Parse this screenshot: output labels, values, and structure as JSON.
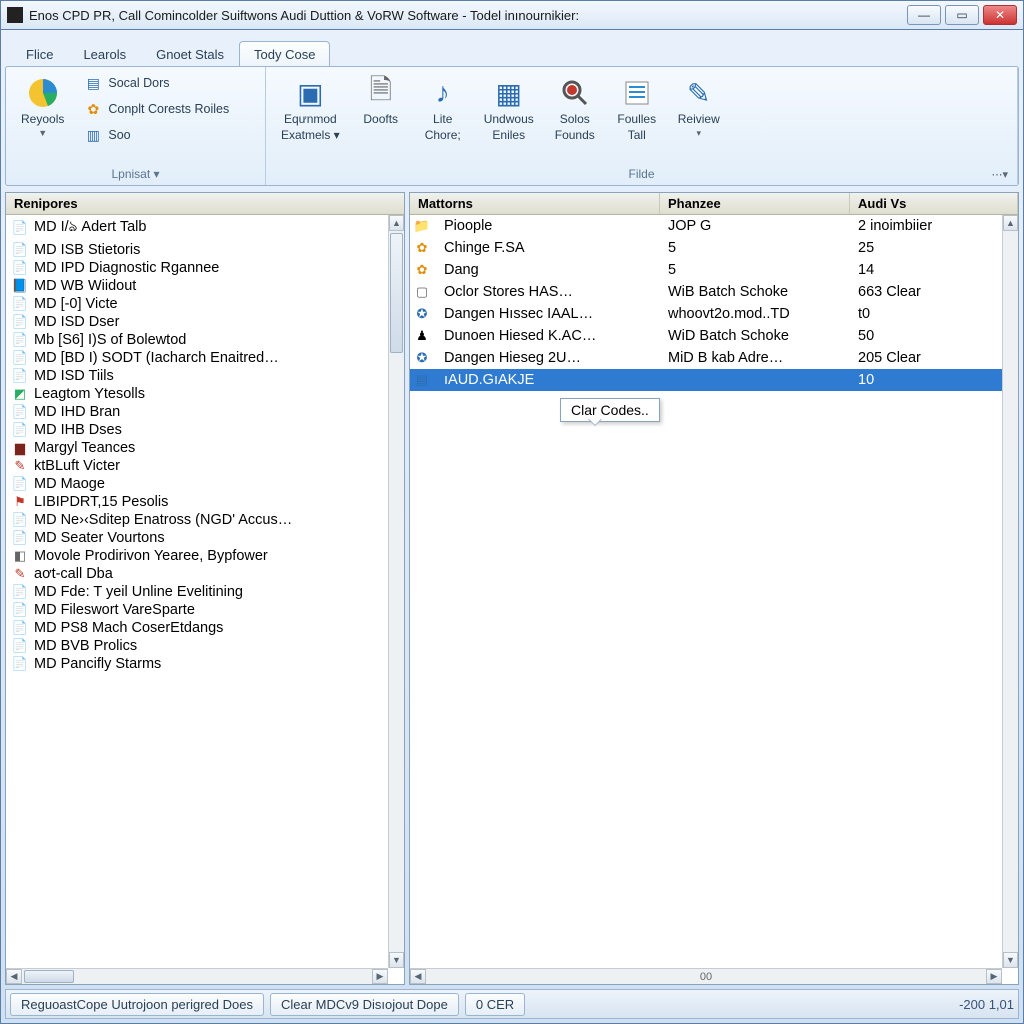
{
  "window": {
    "title": "Enos CPD PR, Call Comincolder Suiftwons Audi Duttion & VoRW Software - Todel inınournikier:"
  },
  "tabs": [
    {
      "label": "Flice"
    },
    {
      "label": "Learols"
    },
    {
      "label": "Gnoet Stals"
    },
    {
      "label": "Tody Cose",
      "active": true
    }
  ],
  "ribbon": {
    "group1": {
      "caption": "Lpnisat ▾",
      "bigbtn": {
        "label": "Reyools"
      },
      "small": [
        {
          "label": "Socal Dors"
        },
        {
          "label": "Conplt Corests Roiles"
        },
        {
          "label": "Soo"
        }
      ]
    },
    "group2": {
      "caption": "Filde",
      "btns": [
        {
          "label1": "Eqưnmod",
          "label2": "Exatmels ▾"
        },
        {
          "label1": "Doofts",
          "label2": ""
        },
        {
          "label1": "Lite",
          "label2": "Chore;"
        },
        {
          "label1": "Undwous",
          "label2": "Eniles"
        },
        {
          "label1": "Solos",
          "label2": "Founds"
        },
        {
          "label1": "Foulles",
          "label2": "Tall"
        },
        {
          "label1": "Reiview",
          "label2": "▾"
        }
      ]
    }
  },
  "leftPanel": {
    "header": "Renipores",
    "items": [
      {
        "icon": "📄",
        "cls": "ic-red",
        "label": "MD I/ঌ Adert Talb"
      },
      {
        "icon": "📄",
        "cls": "ic-red",
        "label": "MD ISB Stietoris"
      },
      {
        "icon": "📄",
        "cls": "ic-red",
        "label": "MD IPD Diagnostic Rgannee"
      },
      {
        "icon": "📘",
        "cls": "ic-blue",
        "label": "MD WB Wiidout"
      },
      {
        "icon": "📄",
        "cls": "ic-red",
        "label": "MD [-0] Victe"
      },
      {
        "icon": "📄",
        "cls": "ic-red",
        "label": "MD ISD Dser"
      },
      {
        "icon": "📄",
        "cls": "ic-red",
        "label": "Mb [S6] I)S of Bolewtod"
      },
      {
        "icon": "📄",
        "cls": "ic-red",
        "label": "MD [BD I) SODT (Iacharch Enaitred…"
      },
      {
        "icon": "📄",
        "cls": "ic-red",
        "label": "MD ISD Tiils"
      },
      {
        "icon": "◩",
        "cls": "ic-green",
        "label": "Leagtom Ytesolls"
      },
      {
        "icon": "📄",
        "cls": "ic-red",
        "label": "MD IHD Bran"
      },
      {
        "icon": "📄",
        "cls": "ic-red",
        "label": "MD IHB Dses"
      },
      {
        "icon": "▆",
        "cls": "ic-darkred",
        "label": "Margyl Teances"
      },
      {
        "icon": "✎",
        "cls": "ic-red",
        "label": "ktBLuft Victer"
      },
      {
        "icon": "📄",
        "cls": "ic-red",
        "label": "MD Maoge"
      },
      {
        "icon": "⚑",
        "cls": "ic-red",
        "label": "LIBIPDRT,15 Pesolis"
      },
      {
        "icon": "📄",
        "cls": "ic-red",
        "label": "MD Ne›‹Sditep Enatross (NGD' Accus…"
      },
      {
        "icon": "📄",
        "cls": "ic-red",
        "label": "MD Seater Vourtons"
      },
      {
        "icon": "◧",
        "cls": "ic-grey",
        "label": "Movole Prodirivon Yearee, Bypfower"
      },
      {
        "icon": "✎",
        "cls": "ic-red",
        "label": "aơt-call Dba"
      },
      {
        "icon": "📄",
        "cls": "ic-red",
        "label": "MD Fde: T yeil Unline Evelitining"
      },
      {
        "icon": "📄",
        "cls": "ic-red",
        "label": "MD Fileswort VareSparte"
      },
      {
        "icon": "📄",
        "cls": "ic-red",
        "label": "MD PS8 Mach CoserEtdangs"
      },
      {
        "icon": "📄",
        "cls": "ic-red",
        "label": "MD BVB Prolics"
      },
      {
        "icon": "📄",
        "cls": "ic-red",
        "label": "MD Pancifly Starms"
      }
    ]
  },
  "rightPanel": {
    "columns": [
      "Mattorns",
      "Phanzee",
      "Audi Vs"
    ],
    "rows": [
      {
        "icon": "📁",
        "cls": "ic-orange",
        "c1": "Pioople",
        "c2": "JOP G",
        "c3": "2 inoimbiier"
      },
      {
        "icon": "✿",
        "cls": "ic-orange",
        "c1": "Chinge F.SA",
        "c2": "5",
        "c3": "25"
      },
      {
        "icon": "✿",
        "cls": "ic-orange",
        "c1": "Dang",
        "c2": "5",
        "c3": "14"
      },
      {
        "icon": "▢",
        "cls": "ic-grey",
        "c1": "Oclor Stores HAS…",
        "c2": "WiB Batch Schoke",
        "c3": "663 Clear"
      },
      {
        "icon": "✪",
        "cls": "ic-blue",
        "c1": "Dangen Hıssec IAAL…",
        "c2": "whoovt2o.mod..TD",
        "c3": "t0"
      },
      {
        "icon": "♟",
        "cls": "",
        "c1": "Dunoen Hiesed K.AC…",
        "c2": "WiD Batch Schoke",
        "c3": "50"
      },
      {
        "icon": "✪",
        "cls": "ic-blue",
        "c1": "Dangen Hieseg 2U…",
        "c2": "MiD B kab Adre…",
        "c3": "205 Clear"
      },
      {
        "icon": "▤",
        "cls": "ic-blue",
        "c1": "ıAUD.GıAKJE",
        "c2": "",
        "c3": "10",
        "sel": true
      }
    ],
    "tooltip": "Clar Codes.."
  },
  "statusbar": {
    "btn1": "ReguoastCope Uutrojoon perigred Does",
    "btn2": "Clear MDCv9 Disıojout Dope",
    "btn3": "0 CER",
    "right": "-200 1,01"
  },
  "hscroll_page": "00"
}
